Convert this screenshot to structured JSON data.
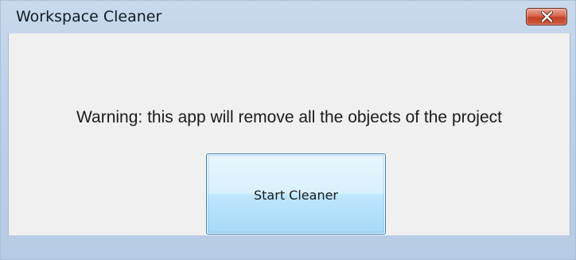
{
  "window": {
    "title": "Workspace Cleaner",
    "close_icon": "close-icon"
  },
  "content": {
    "warning_text": "Warning: this app will remove all the objects of the project",
    "start_button_label": "Start Cleaner"
  },
  "colors": {
    "title_bar": "#bcd0e8",
    "client_background": "#f0f0f0",
    "close_button": "#c24329",
    "start_button": "#bee6fd",
    "start_button_border": "#3c7fb1"
  }
}
